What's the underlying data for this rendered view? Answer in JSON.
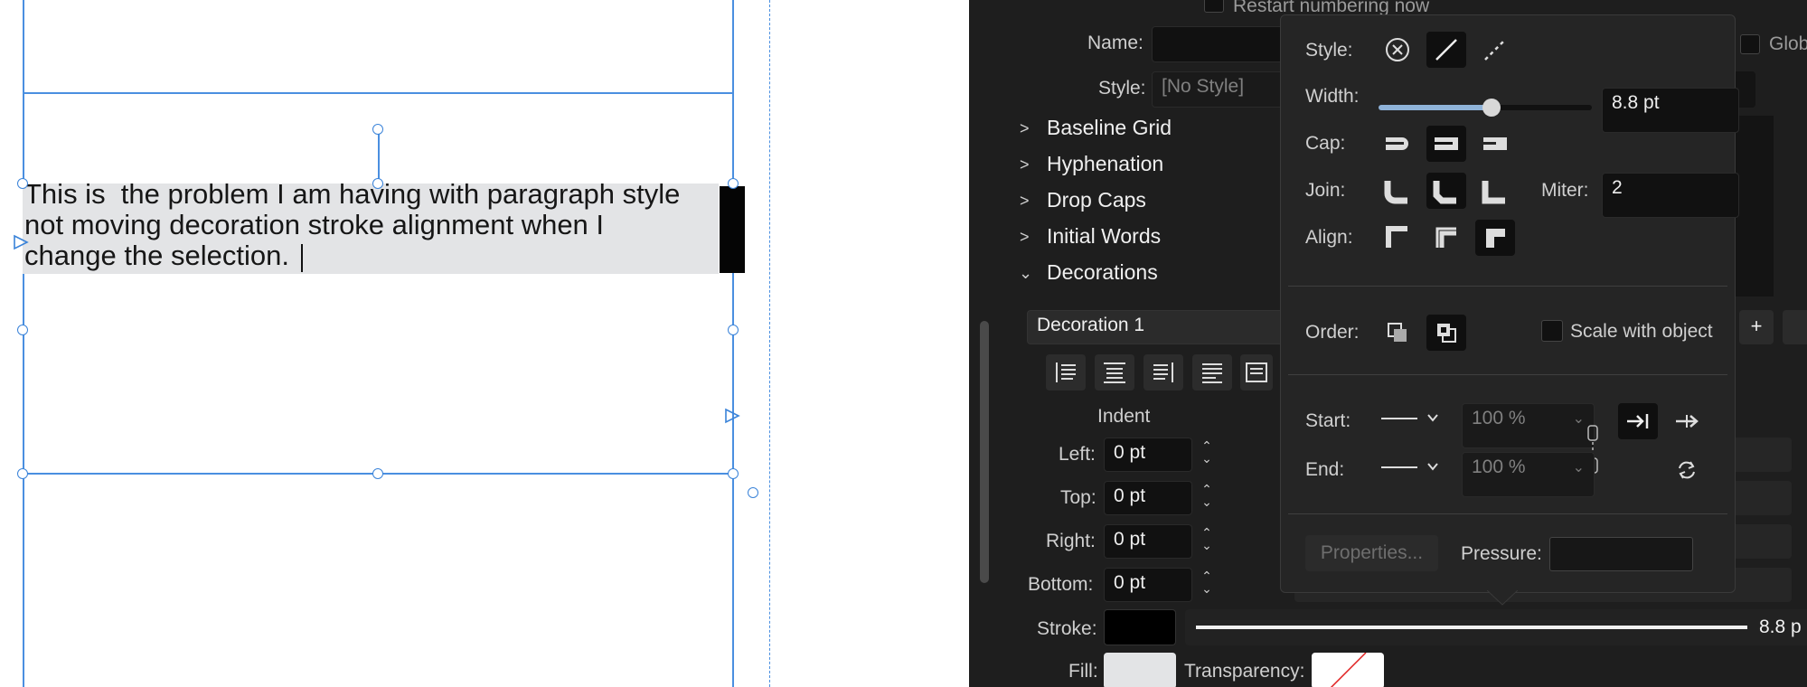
{
  "document": {
    "text": "This is  the problem I am having with paragraph style\nnot moving decoration stroke alignment when I\nchange the selection."
  },
  "panel": {
    "restart_numbering": "Restart numbering now",
    "name_label": "Name:",
    "name_value": "",
    "style_label": "Style:",
    "style_value": "[No Style]",
    "global_label": "Glob",
    "sections": [
      "Baseline Grid",
      "Hyphenation",
      "Drop Caps",
      "Initial Words",
      "Decorations"
    ],
    "decoration_name": "Decoration 1",
    "add_label": "+",
    "indent_title": "Indent",
    "indent_left_label": "Left:",
    "indent_left_value": "0 pt",
    "indent_top_label": "Top:",
    "indent_top_value": "0 pt",
    "indent_right_label": "Right:",
    "indent_right_value": "0 pt",
    "indent_bottom_label": "Bottom:",
    "indent_bottom_value": "0 pt",
    "stroke_label": "Stroke:",
    "stroke_value": "8.8 p",
    "fill_label": "Fill:",
    "transparency_label": "Transparency:"
  },
  "popover": {
    "style_label": "Style:",
    "width_label": "Width:",
    "width_value": "8.8 pt",
    "width_fraction": 0.53,
    "cap_label": "Cap:",
    "join_label": "Join:",
    "miter_label": "Miter:",
    "miter_value": "2",
    "align_label": "Align:",
    "order_label": "Order:",
    "scale_label": "Scale with object",
    "start_label": "Start:",
    "start_percent": "100 %",
    "end_label": "End:",
    "end_percent": "100 %",
    "properties_label": "Properties...",
    "pressure_label": "Pressure:"
  },
  "colors": {
    "panel_bg": "#1e1e1e",
    "accent_blue": "#4a8fe0",
    "slider_fill": "#8fb3d9"
  }
}
